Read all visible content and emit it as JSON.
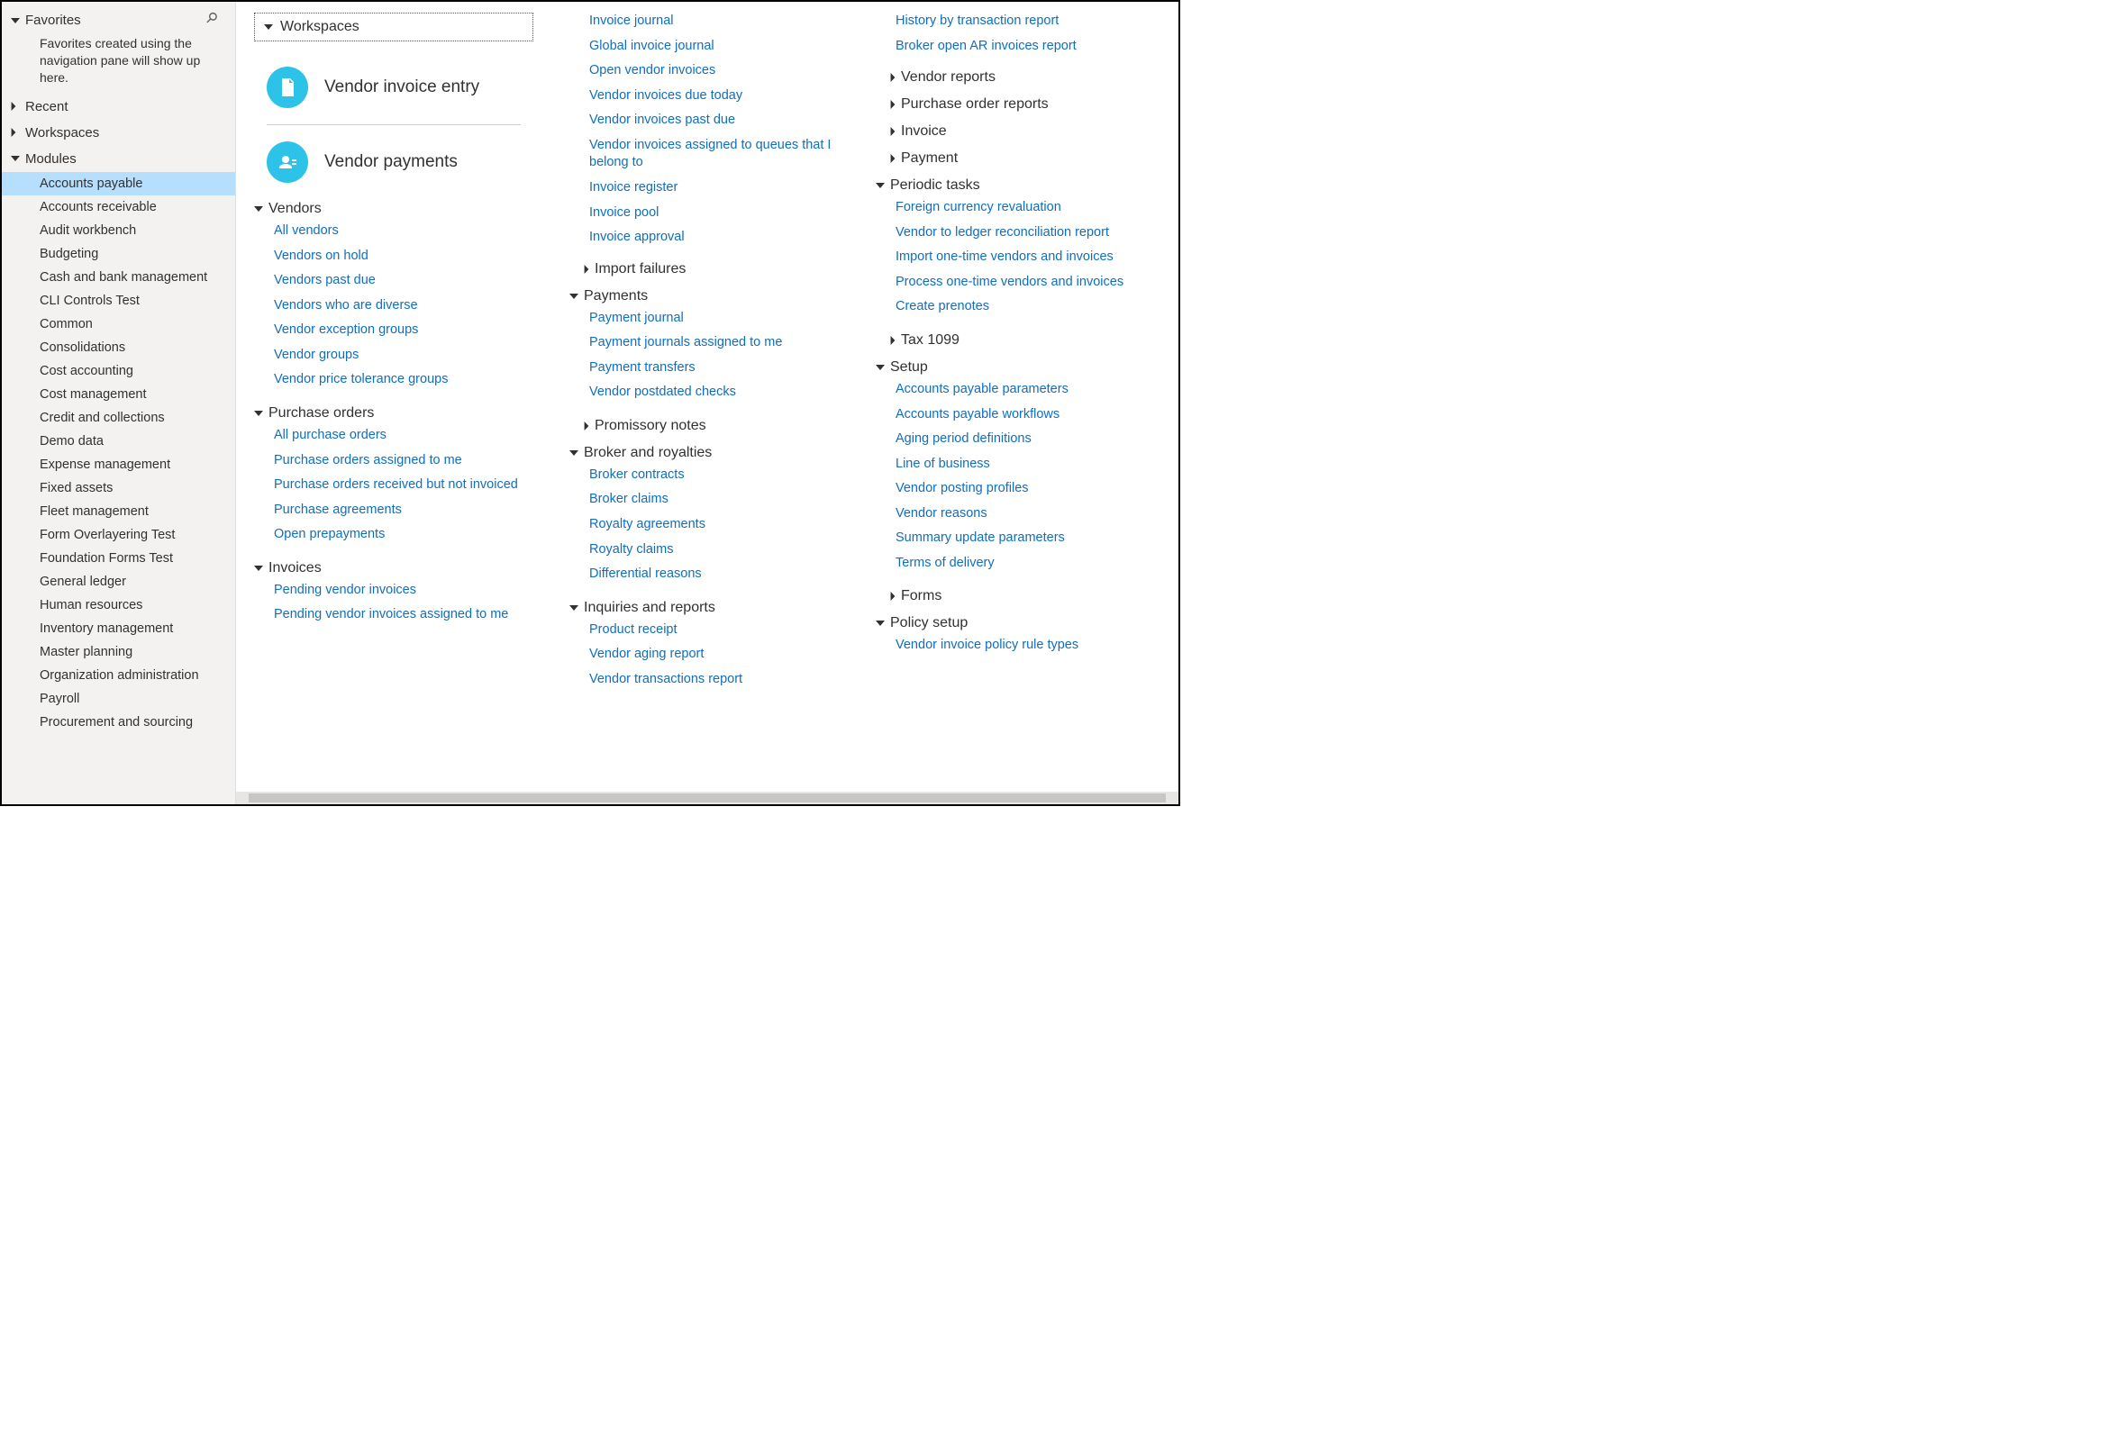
{
  "sidebar": {
    "pin_icon": "pin",
    "sections": [
      {
        "id": "favorites",
        "label": "Favorites",
        "expanded": true,
        "hint": "Favorites created using the navigation pane will show up here."
      },
      {
        "id": "recent",
        "label": "Recent",
        "expanded": false
      },
      {
        "id": "workspaces",
        "label": "Workspaces",
        "expanded": false
      },
      {
        "id": "modules",
        "label": "Modules",
        "expanded": true
      }
    ],
    "modules": [
      "Accounts payable",
      "Accounts receivable",
      "Audit workbench",
      "Budgeting",
      "Cash and bank management",
      "CLI Controls Test",
      "Common",
      "Consolidations",
      "Cost accounting",
      "Cost management",
      "Credit and collections",
      "Demo data",
      "Expense management",
      "Fixed assets",
      "Fleet management",
      "Form Overlayering Test",
      "Foundation Forms Test",
      "General ledger",
      "Human resources",
      "Inventory management",
      "Master planning",
      "Organization administration",
      "Payroll",
      "Procurement and sourcing"
    ],
    "selected_module_index": 0
  },
  "content": {
    "workspaces_header": "Workspaces",
    "workspace_tiles": [
      {
        "label": "Vendor invoice entry",
        "icon": "invoice-icon"
      },
      {
        "label": "Vendor payments",
        "icon": "payments-icon"
      }
    ],
    "col1_groups": [
      {
        "label": "Vendors",
        "expanded": true,
        "links": [
          "All vendors",
          "Vendors on hold",
          "Vendors past due",
          "Vendors who are diverse",
          "Vendor exception groups",
          "Vendor groups",
          "Vendor price tolerance groups"
        ]
      },
      {
        "label": "Purchase orders",
        "expanded": true,
        "links": [
          "All purchase orders",
          "Purchase orders assigned to me",
          "Purchase orders received but not invoiced",
          "Purchase agreements",
          "Open prepayments"
        ]
      },
      {
        "label": "Invoices",
        "expanded": true,
        "links": [
          "Pending vendor invoices",
          "Pending vendor invoices assigned to me"
        ]
      }
    ],
    "col2_top_links": [
      "Invoice journal",
      "Global invoice journal",
      "Open vendor invoices",
      "Vendor invoices due today",
      "Vendor invoices past due",
      "Vendor invoices assigned to queues that I belong to",
      "Invoice register",
      "Invoice pool",
      "Invoice approval"
    ],
    "col2_groups": [
      {
        "label": "Import failures",
        "expanded": false,
        "indent": true
      },
      {
        "label": "Payments",
        "expanded": true,
        "links": [
          "Payment journal",
          "Payment journals assigned to me",
          "Payment transfers",
          "Vendor postdated checks"
        ]
      },
      {
        "label": "Promissory notes",
        "expanded": false,
        "indent": true
      },
      {
        "label": "Broker and royalties",
        "expanded": true,
        "links": [
          "Broker contracts",
          "Broker claims",
          "Royalty agreements",
          "Royalty claims",
          "Differential reasons"
        ]
      },
      {
        "label": "Inquiries and reports",
        "expanded": true,
        "links": [
          "Product receipt",
          "Vendor aging report",
          "Vendor transactions report"
        ]
      }
    ],
    "col3_top_links": [
      "History by transaction report",
      "Broker open AR invoices report"
    ],
    "col3_groups": [
      {
        "label": "Vendor reports",
        "expanded": false,
        "indent": true
      },
      {
        "label": "Purchase order reports",
        "expanded": false,
        "indent": true
      },
      {
        "label": "Invoice",
        "expanded": false,
        "indent": true
      },
      {
        "label": "Payment",
        "expanded": false,
        "indent": true
      },
      {
        "label": "Periodic tasks",
        "expanded": true,
        "links": [
          "Foreign currency revaluation",
          "Vendor to ledger reconciliation report",
          "Import one-time vendors and invoices",
          "Process one-time vendors and invoices",
          "Create prenotes"
        ]
      },
      {
        "label": "Tax 1099",
        "expanded": false,
        "indent": true
      },
      {
        "label": "Setup",
        "expanded": true,
        "links": [
          "Accounts payable parameters",
          "Accounts payable workflows",
          "Aging period definitions",
          "Line of business",
          "Vendor posting profiles",
          "Vendor reasons",
          "Summary update parameters",
          "Terms of delivery"
        ]
      },
      {
        "label": "Forms",
        "expanded": false,
        "indent": true
      },
      {
        "label": "Policy setup",
        "expanded": true,
        "links": [
          "Vendor invoice policy rule types"
        ]
      }
    ]
  }
}
